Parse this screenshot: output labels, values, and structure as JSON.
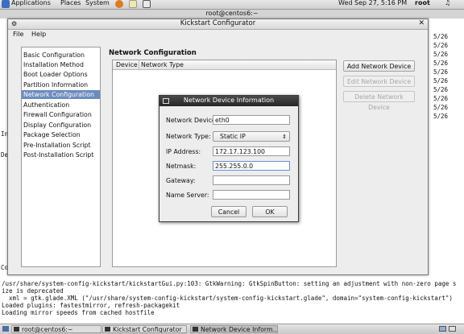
{
  "top_panel": {
    "applications": "Applications",
    "places": "Places",
    "system": "System",
    "clock": "Wed Sep 27,  5:16 PM",
    "user": "root"
  },
  "terminal": {
    "title": "root@centos6:~",
    "right_fragments": [
      "5/26",
      "5/26",
      "5/26",
      "5/26",
      "5/26",
      "5/26",
      "5/26",
      "5/26",
      "5/26",
      "5/26",
      "5/26",
      "5/26",
      "5/26",
      "5/26",
      "5/26",
      "5/26",
      "5/26",
      "5/26",
      "5/26"
    ],
    "left_fragments": {
      "in": "In",
      "de": "De",
      "co": "Co"
    },
    "lines": [
      "/usr/share/system-config-kickstart/kickstartGui.py:103: GtkWarning: GtkSpinButton: setting an adjustment with non-zero page s",
      "ize is deprecated",
      "  xml = gtk.glade.XML (\"/usr/share/system-config-kickstart/system-config-kickstart.glade\", domain=\"system-config-kickstart\")",
      "Loaded plugins: fastestmirror, refresh-packagekit",
      "Loading mirror speeds from cached hostfile"
    ]
  },
  "kickstart": {
    "title": "Kickstart Configurator",
    "menu": [
      "File",
      "Help"
    ],
    "nav_items": [
      "Basic Configuration",
      "Installation Method",
      "Boot Loader Options",
      "Partition Information",
      "Network Configuration",
      "Authentication",
      "Firewall Configuration",
      "Display Configuration",
      "Package Selection",
      "Pre-Installation Script",
      "Post-Installation Script"
    ],
    "selected_nav": "Network Configuration",
    "section_title": "Network Configuration",
    "table_headers": [
      "Device",
      "Network Type"
    ],
    "buttons": {
      "add": "Add Network Device",
      "edit": "Edit Network Device",
      "delete": "Delete Network Device"
    }
  },
  "dialog": {
    "title": "Network Device Information",
    "labels": {
      "device": "Network Device:",
      "type": "Network Type:",
      "ip": "IP Address:",
      "netmask": "Netmask:",
      "gateway": "Gateway:",
      "nameserver": "Name Server:"
    },
    "values": {
      "device": "eth0",
      "type": "Static IP",
      "ip": "172.17.123.100",
      "netmask": "255.255.0.0",
      "gateway": "",
      "nameserver": ""
    },
    "cancel": "Cancel",
    "ok": "OK"
  },
  "taskbar": {
    "items": [
      "root@centos6:~",
      "Kickstart Configurator",
      "Network Device Inform..."
    ]
  }
}
